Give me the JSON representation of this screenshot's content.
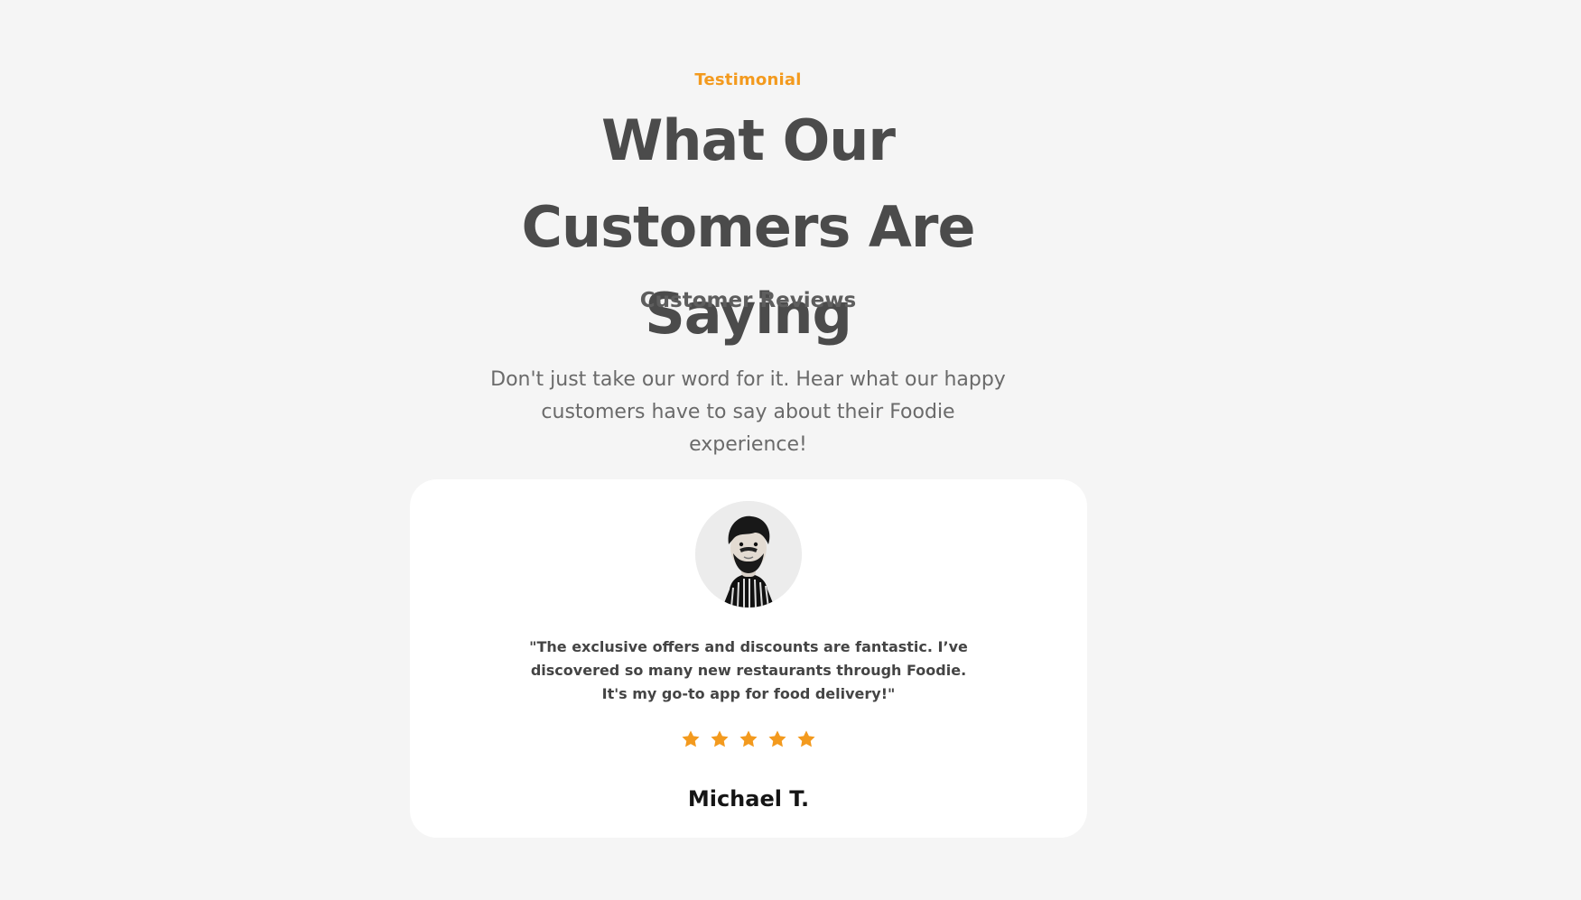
{
  "header": {
    "eyebrow": "Testimonial",
    "title": "What Our Customers Are Saying",
    "subtitle": "Customer Reviews",
    "intro": "Don't just take our word for it. Hear what our happy customers have to say about their Foodie experience!"
  },
  "testimonial": {
    "avatar_icon": "customer-avatar-icon",
    "quote": "\"The exclusive offers and discounts are fantastic. I’ve discovered so many new restaurants through Foodie. It's my go-to app for food delivery!\"",
    "rating": 5,
    "rating_max": 5,
    "name": "Michael T."
  },
  "colors": {
    "accent": "#f39a1e",
    "heading": "#4b4b4b",
    "background": "#f5f5f5",
    "card": "#ffffff"
  }
}
